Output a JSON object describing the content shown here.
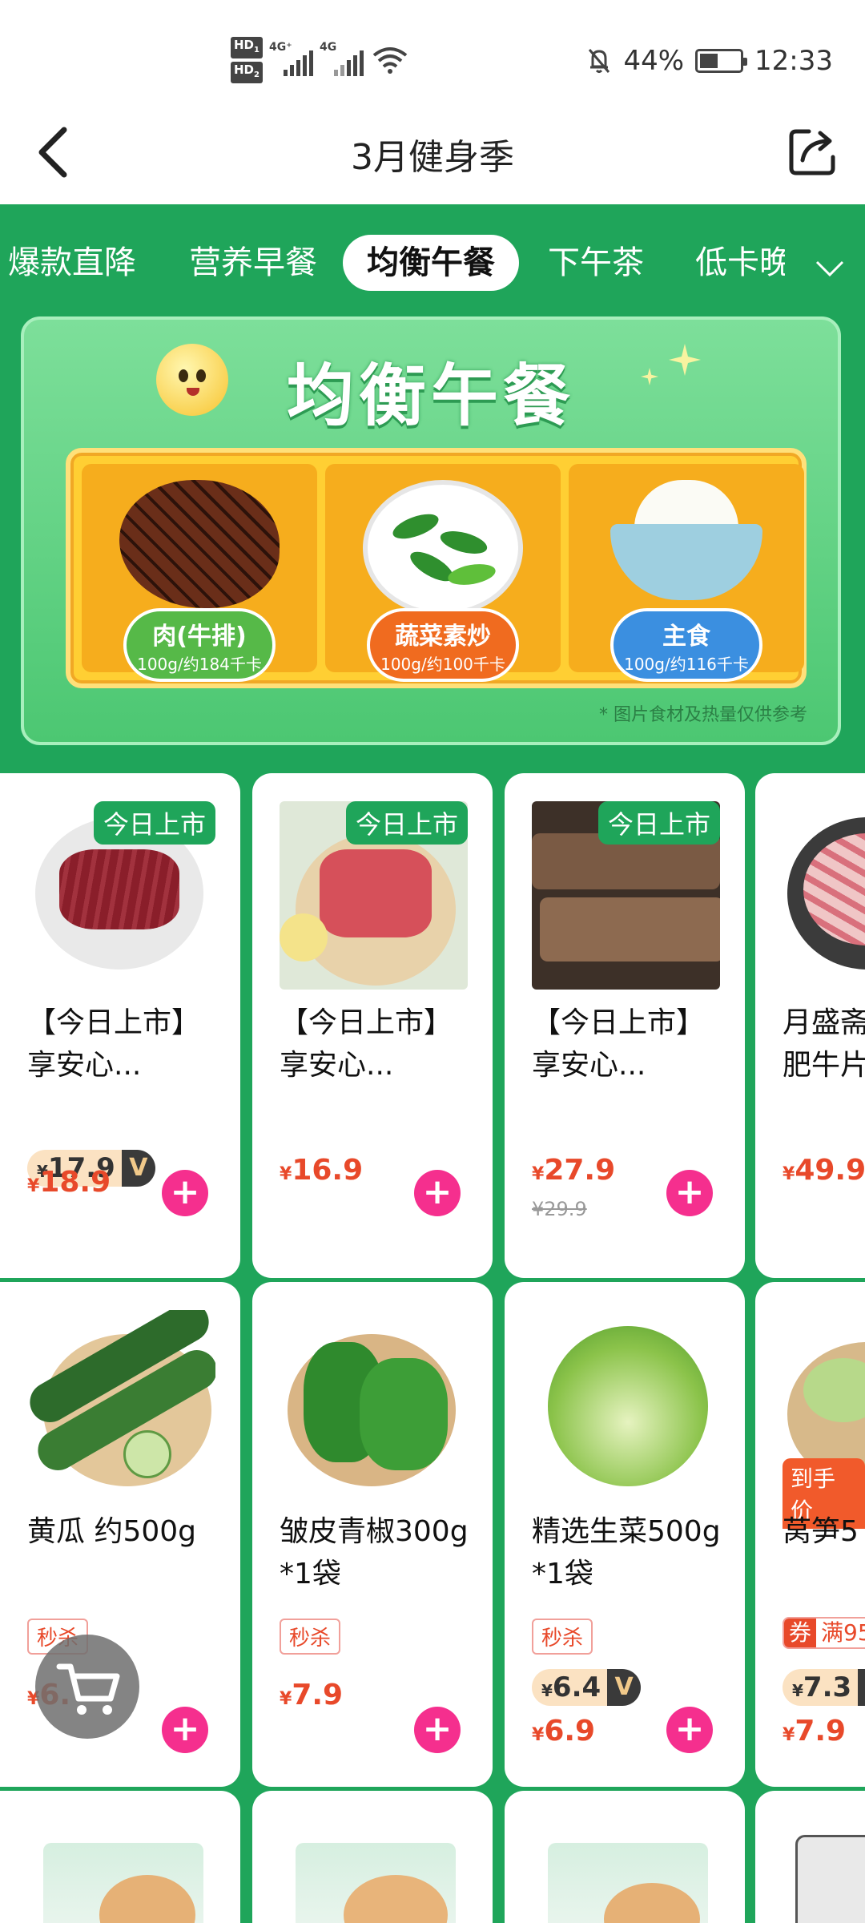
{
  "status_bar": {
    "hd1": "HD",
    "hd1_sub": "1",
    "hd2": "HD",
    "hd2_sub": "2",
    "net1": "4G⁺",
    "net2": "4G",
    "battery": "44%",
    "time": "12:33",
    "icons": [
      "signal-icon",
      "wifi-icon",
      "mute-bell-icon",
      "battery-icon"
    ]
  },
  "header": {
    "title": "3月健身季",
    "back_icon": "chevron-left-icon",
    "share_icon": "share-icon"
  },
  "tabs": {
    "items": [
      "爆款直降",
      "营养早餐",
      "均衡午餐",
      "下午茶",
      "低卡晚"
    ],
    "active": "均衡午餐",
    "expand_icon": "chevron-down-icon"
  },
  "banner": {
    "title": "均衡午餐",
    "items": [
      {
        "name": "肉(牛排)",
        "calories": "100g/约184千卡"
      },
      {
        "name": "蔬菜素炒",
        "calories": "100g/约100千卡"
      },
      {
        "name": "主食",
        "calories": "100g/约116千卡"
      }
    ],
    "note": "* 图片食材及热量仅供参考"
  },
  "products_row1": [
    {
      "badge": "今日上市",
      "name": "【今日上市】享安心...",
      "vip_symbol": "¥",
      "vip_price": "17.9",
      "vip_mark": "V",
      "price_symbol": "¥",
      "price": "18.9"
    },
    {
      "badge": "今日上市",
      "name": "【今日上市】享安心...",
      "price_symbol": "¥",
      "price": "16.9"
    },
    {
      "badge": "今日上市",
      "name": "【今日上市】享安心...",
      "price_symbol": "¥",
      "price": "27.9",
      "original_price": "¥29.9"
    },
    {
      "name": "月盛斋肥牛片",
      "price_symbol": "¥",
      "price": "49.9"
    }
  ],
  "products_row2": [
    {
      "name": "黄瓜 约500g",
      "tag": "秒杀",
      "price_symbol": "¥",
      "price": "6."
    },
    {
      "name": "皱皮青椒300g*1袋",
      "tag": "秒杀",
      "price_symbol": "¥",
      "price": "7.9"
    },
    {
      "name": "精选生菜500g*1袋",
      "tag": "秒杀",
      "vip_symbol": "¥",
      "vip_price": "6.4",
      "vip_mark": "V",
      "price_symbol": "¥",
      "price": "6.9"
    },
    {
      "name": "莴笋5",
      "final_tag": "到手价",
      "coupon_mark": "券",
      "coupon_text": "满95",
      "vip_symbol": "¥",
      "vip_price": "7.3",
      "vip_mark": "V",
      "price_symbol": "¥",
      "price": "7.9"
    }
  ],
  "add_button": "+",
  "colors": {
    "brand_green": "#1fa55a",
    "price_red": "#e8492a",
    "add_pink": "#f52f8e"
  }
}
